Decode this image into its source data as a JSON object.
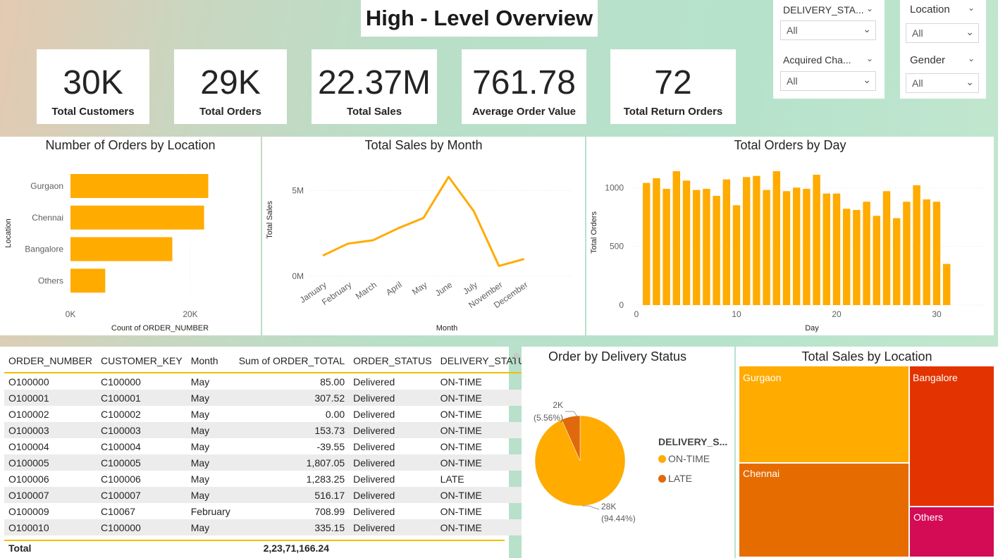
{
  "page_title": "High - Level Overview",
  "kpis": [
    {
      "value": "30K",
      "label": "Total Customers"
    },
    {
      "value": "29K",
      "label": "Total Orders"
    },
    {
      "value": "22.37M",
      "label": "Total Sales"
    },
    {
      "value": "761.78",
      "label": "Average Order Value"
    },
    {
      "value": "72",
      "label": "Total Return Orders"
    }
  ],
  "slicers": {
    "delivery_status": {
      "label": "DELIVERY_STA...",
      "value": "All"
    },
    "acquired_channel": {
      "label": "Acquired Cha...",
      "value": "All"
    },
    "location": {
      "label": "Location",
      "value": "All"
    },
    "gender": {
      "label": "Gender",
      "value": "All"
    }
  },
  "colors": {
    "accent": "#FFAB00",
    "orange_dark": "#E66C00",
    "red": "#E33300",
    "magenta": "#D40B55",
    "slice_late": "#E06A0B"
  },
  "chart_data": [
    {
      "type": "bar",
      "orientation": "horizontal",
      "title": "Number of Orders by Location",
      "ylabel": "Location",
      "xlabel": "Count of ORDER_NUMBER",
      "categories": [
        "Gurgaon",
        "Chennai",
        "Bangalore",
        "Others"
      ],
      "values": [
        23000,
        22300,
        17000,
        5800
      ],
      "xticks": [
        "0K",
        "20K"
      ],
      "xlim": [
        0,
        28000
      ]
    },
    {
      "type": "line",
      "title": "Total Sales by Month",
      "ylabel": "Total Sales",
      "xlabel": "Month",
      "categories": [
        "January",
        "February",
        "March",
        "April",
        "May",
        "June",
        "July",
        "November",
        "December"
      ],
      "values": [
        1200000,
        1900000,
        2100000,
        2800000,
        3400000,
        5800000,
        3800000,
        600000,
        1000000
      ],
      "yticks": [
        "0M",
        "5M"
      ],
      "ylim": [
        0,
        6500000
      ]
    },
    {
      "type": "bar",
      "title": "Total Orders by Day",
      "ylabel": "Total Orders",
      "xlabel": "Day",
      "x": [
        1,
        2,
        3,
        4,
        5,
        6,
        7,
        8,
        9,
        10,
        11,
        12,
        13,
        14,
        15,
        16,
        17,
        18,
        19,
        20,
        21,
        22,
        23,
        24,
        25,
        26,
        27,
        28,
        29,
        30,
        31
      ],
      "values": [
        1040,
        1080,
        990,
        1140,
        1060,
        980,
        990,
        930,
        1070,
        850,
        1090,
        1100,
        980,
        1140,
        970,
        1000,
        990,
        1110,
        950,
        950,
        820,
        810,
        880,
        760,
        970,
        740,
        880,
        1020,
        900,
        880,
        350
      ],
      "yticks": [
        "0",
        "500",
        "1000"
      ],
      "xticks": [
        "0",
        "10",
        "20",
        "30"
      ],
      "ylim": [
        0,
        1200
      ],
      "xlim": [
        0,
        33
      ]
    },
    {
      "type": "pie",
      "title": "Order by Delivery Status",
      "legend_title": "DELIVERY_S...",
      "slices": [
        {
          "name": "ON-TIME",
          "value": 28000,
          "label": "28K",
          "pct": "(94.44%)"
        },
        {
          "name": "LATE",
          "value": 2000,
          "label": "2K",
          "pct": "(5.56%)"
        }
      ]
    },
    {
      "type": "treemap",
      "title": "Total Sales by Location",
      "items": [
        {
          "name": "Gurgaon"
        },
        {
          "name": "Chennai"
        },
        {
          "name": "Bangalore"
        },
        {
          "name": "Others"
        }
      ]
    }
  ],
  "table": {
    "columns": [
      "ORDER_NUMBER",
      "CUSTOMER_KEY",
      "Month",
      "Sum of ORDER_TOTAL",
      "ORDER_STATUS",
      "DELIVERY_STATUS"
    ],
    "rows": [
      [
        "O100000",
        "C100000",
        "May",
        "85.00",
        "Delivered",
        "ON-TIME"
      ],
      [
        "O100001",
        "C100001",
        "May",
        "307.52",
        "Delivered",
        "ON-TIME"
      ],
      [
        "O100002",
        "C100002",
        "May",
        "0.00",
        "Delivered",
        "ON-TIME"
      ],
      [
        "O100003",
        "C100003",
        "May",
        "153.73",
        "Delivered",
        "ON-TIME"
      ],
      [
        "O100004",
        "C100004",
        "May",
        "-39.55",
        "Delivered",
        "ON-TIME"
      ],
      [
        "O100005",
        "C100005",
        "May",
        "1,807.05",
        "Delivered",
        "ON-TIME"
      ],
      [
        "O100006",
        "C100006",
        "May",
        "1,283.25",
        "Delivered",
        "LATE"
      ],
      [
        "O100007",
        "C100007",
        "May",
        "516.17",
        "Delivered",
        "ON-TIME"
      ],
      [
        "O100009",
        "C10067",
        "February",
        "708.99",
        "Delivered",
        "ON-TIME"
      ],
      [
        "O100010",
        "C100000",
        "May",
        "335.15",
        "Delivered",
        "ON-TIME"
      ]
    ],
    "total_label": "Total",
    "total_value": "2,23,71,166.24"
  }
}
